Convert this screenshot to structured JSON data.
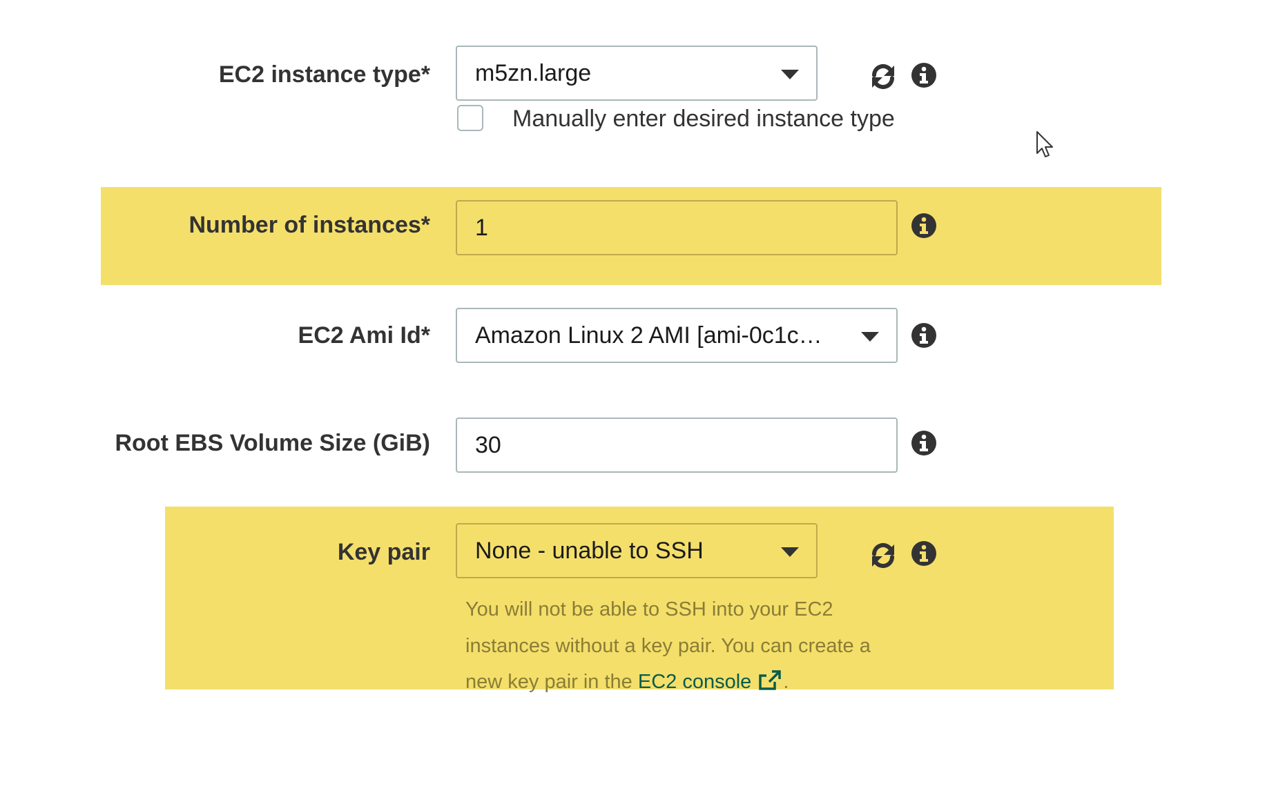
{
  "form": {
    "instance_type": {
      "label": "EC2 instance type*",
      "value": "m5zn.large",
      "manual_checkbox_label": "Manually enter desired instance type",
      "manual_checked": false
    },
    "instances": {
      "label": "Number of instances*",
      "value": "1"
    },
    "ami": {
      "label": "EC2 Ami Id*",
      "value": "Amazon Linux 2 AMI [ami-0c1c…"
    },
    "root_ebs": {
      "label": "Root EBS Volume Size (GiB)",
      "value": "30"
    },
    "key_pair": {
      "label": "Key pair",
      "value": "None - unable to SSH",
      "help_text": "You will not be able to SSH into your EC2 instances without a key pair. You can create a new key pair in the",
      "link_text": "EC2 console",
      "help_suffix": "."
    }
  },
  "icons": {
    "refresh": "refresh-icon",
    "info": "info-icon",
    "caret": "chevron-down-icon",
    "external_link": "external-link-icon",
    "cursor": "mouse-cursor-icon"
  },
  "colors": {
    "highlight": "#f4df6b",
    "link": "#0a5b4b",
    "help_text": "#8a7d35",
    "border": "#aab7b8",
    "text": "#333333"
  }
}
